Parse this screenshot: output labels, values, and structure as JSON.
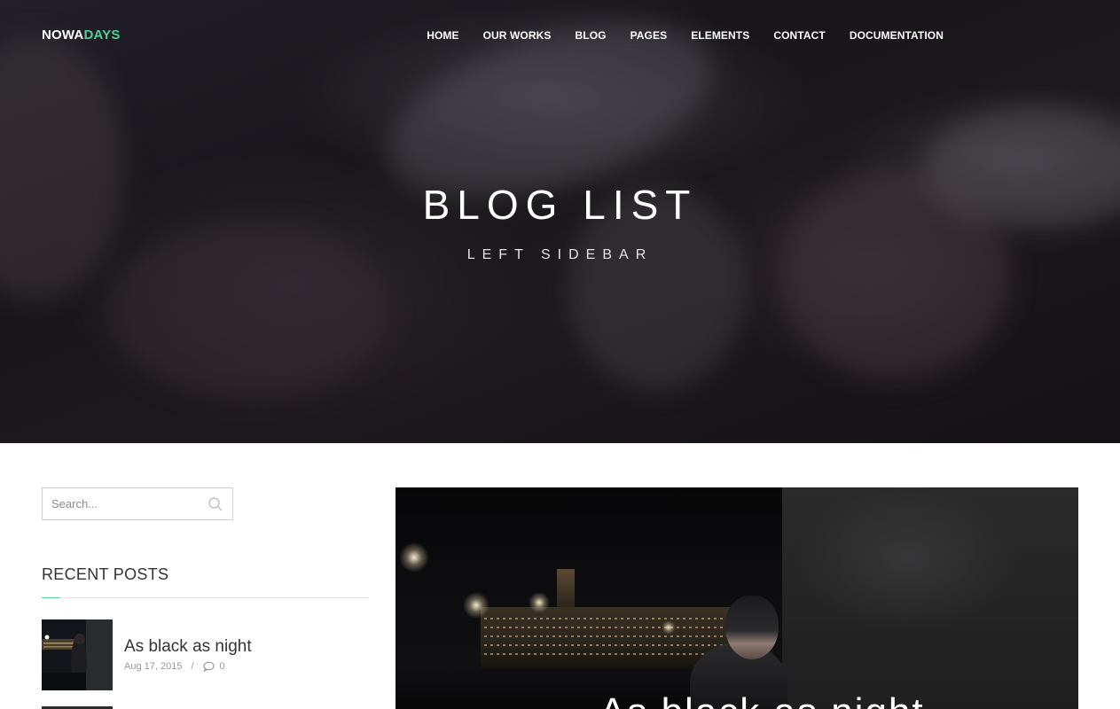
{
  "header": {
    "logo_part1": "NOWA",
    "logo_part2": "DAYS",
    "nav": [
      {
        "label": "HOME"
      },
      {
        "label": "OUR WORKS"
      },
      {
        "label": "BLOG"
      },
      {
        "label": "PAGES"
      },
      {
        "label": "ELEMENTS"
      },
      {
        "label": "CONTACT"
      },
      {
        "label": "DOCUMENTATION"
      }
    ]
  },
  "hero": {
    "title": "BLOG LIST",
    "subtitle": "LEFT SIDEBAR"
  },
  "sidebar": {
    "search": {
      "placeholder": "Search..."
    },
    "recent_posts_title": "RECENT POSTS",
    "recent_posts": [
      {
        "title": "As black as night",
        "date": "Aug 17, 2015",
        "separator": "/",
        "comments": "0"
      }
    ]
  },
  "featured_post": {
    "title": "As black as night"
  },
  "colors": {
    "accent": "#4fcf9b",
    "text": "#333333",
    "muted": "#999999"
  },
  "icons": {
    "search": "search-icon",
    "comment": "comment-icon"
  }
}
